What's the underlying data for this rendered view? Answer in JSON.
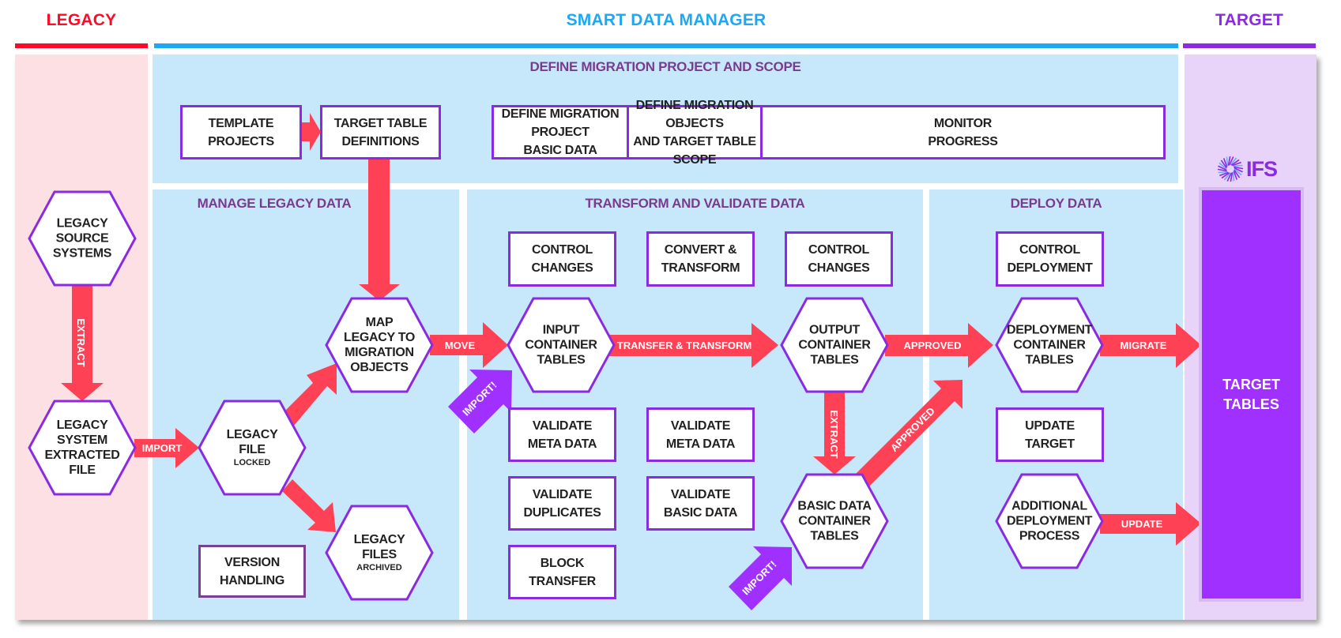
{
  "colors": {
    "legacy": "#ff0a28",
    "smart": "#1ea7f2",
    "target": "#8a2be2",
    "arrow": "#ff4155",
    "import_arrow": "#a030ff",
    "panel_blue": "#c7e8fa",
    "panel_pink": "#fde0e3",
    "panel_lavender": "#e7d4f8",
    "box_border": "#8a2be2",
    "section_title": "#7a3a8f"
  },
  "columns": {
    "legacy": "LEGACY",
    "smart": "SMART DATA MANAGER",
    "target": "TARGET"
  },
  "sections": {
    "define": "DEFINE MIGRATION PROJECT AND SCOPE",
    "manage": "MANAGE LEGACY DATA",
    "transform": "TRANSFORM AND VALIDATE DATA",
    "deploy": "DEPLOY DATA"
  },
  "define_boxes": {
    "template_projects": "TEMPLATE\nPROJECTS",
    "target_table_definitions": "TARGET TABLE\nDEFINITIONS",
    "define_project_basic": "DEFINE MIGRATION PROJECT\nBASIC DATA",
    "define_objects_scope": "DEFINE MIGRATION OBJECTS\nAND TARGET TABLE SCOPE",
    "monitor_progress": "MONITOR\nPROGRESS"
  },
  "hexagons": {
    "legacy_source": [
      "LEGACY",
      "SOURCE",
      "SYSTEMS"
    ],
    "legacy_extracted": [
      "LEGACY",
      "SYSTEM",
      "EXTRACTED",
      "FILE"
    ],
    "legacy_file": [
      "LEGACY",
      "FILE"
    ],
    "legacy_file_sub": "LOCKED",
    "map_legacy": [
      "MAP",
      "LEGACY TO",
      "MIGRATION",
      "OBJECTS"
    ],
    "legacy_files": [
      "LEGACY",
      "FILES"
    ],
    "legacy_files_sub": "ARCHIVED",
    "input_container": [
      "INPUT",
      "CONTAINER",
      "TABLES"
    ],
    "output_container": [
      "OUTPUT",
      "CONTAINER",
      "TABLES"
    ],
    "basic_data_container": [
      "BASIC DATA",
      "CONTAINER",
      "TABLES"
    ],
    "deployment_container": [
      "DEPLOYMENT",
      "CONTAINER",
      "TABLES"
    ],
    "additional_deployment": [
      "ADDITIONAL",
      "DEPLOYMENT",
      "PROCESS"
    ]
  },
  "boxes": {
    "version_handling": "VERSION\nHANDLING",
    "control_changes_1": "CONTROL\nCHANGES",
    "convert_transform": "CONVERT &\nTRANSFORM",
    "control_changes_2": "CONTROL\nCHANGES",
    "validate_meta_1": "VALIDATE\nMETA DATA",
    "validate_meta_2": "VALIDATE\nMETA DATA",
    "validate_duplicates": "VALIDATE\nDUPLICATES",
    "validate_basic": "VALIDATE\nBASIC DATA",
    "block_transfer": "BLOCK\nTRANSFER",
    "control_deployment": "CONTROL\nDEPLOYMENT",
    "update_target": "UPDATE\nTARGET"
  },
  "arrows": {
    "extract_legacy": "EXTRACT",
    "import_legacy": "IMPORT",
    "move": "MOVE",
    "import_input": "IMPORT!",
    "transfer_transform": "TRANSFER & TRANSFORM",
    "approved_output": "APPROVED",
    "extract_output": "EXTRACT",
    "approved_basic": "APPROVED",
    "import_basic": "IMPORT!",
    "migrate": "MIGRATE",
    "update": "UPDATE"
  },
  "target": {
    "logo_text": "IFS",
    "tables": "TARGET\nTABLES"
  }
}
